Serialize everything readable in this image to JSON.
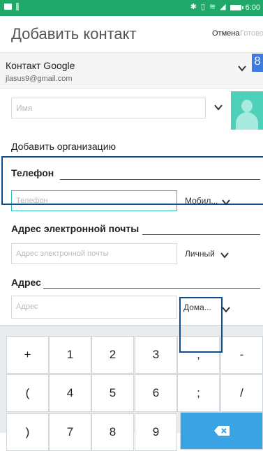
{
  "status_bar": {
    "time": "6:00",
    "icons": [
      "mail-icon",
      "usb-icon",
      "bluetooth-icon",
      "vibrate-icon",
      "wifi-icon",
      "no-signal-icon",
      "battery-icon"
    ]
  },
  "header": {
    "title": "Добавить контакт",
    "cancel_label": "Отмена",
    "done_label": "Готово"
  },
  "account": {
    "name": "Контакт Google",
    "email": "jlasus9@gmail.com",
    "logo_letter": "8"
  },
  "name_field": {
    "placeholder": "Имя"
  },
  "add_organization_label": "Добавить организацию",
  "phone": {
    "section_label": "Телефон",
    "placeholder": "Телефон",
    "type": "Мобил..."
  },
  "email": {
    "section_label": "Адрес электронной почты",
    "placeholder": "Адрес электронной почты",
    "type": "Личный"
  },
  "address": {
    "section_label": "Адрес",
    "placeholder": "Адрес",
    "type": "Дома..."
  },
  "keyboard": {
    "rows": [
      [
        "+",
        "1",
        "2",
        "3",
        ",",
        "-"
      ],
      [
        "(",
        "4",
        "5",
        "6",
        ";",
        "/"
      ],
      [
        ")",
        "7",
        "8",
        "9",
        ""
      ]
    ],
    "enter_key": "backspace"
  },
  "colors": {
    "status_bar": "#1fa86a",
    "accent_focus": "#2dbfb3",
    "highlight_box": "#0f4c8a",
    "avatar_bg": "#4fd0b8",
    "enter_key": "#3aa3e3"
  }
}
